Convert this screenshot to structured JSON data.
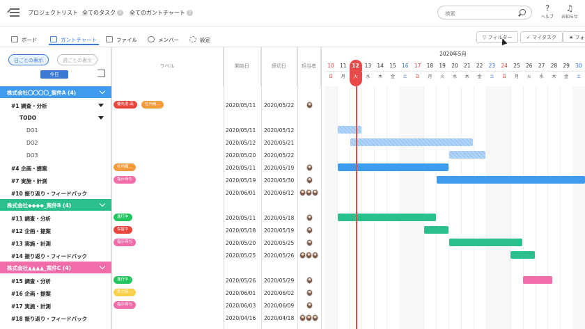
{
  "topbar": {
    "project_list": "プロジェクトリスト",
    "all_tasks": "全てのタスク",
    "all_gantt": "全てのガントチャート",
    "search_placeholder": "検索",
    "help": "ヘルプ",
    "notifications": "お知らせ"
  },
  "tabs": [
    {
      "label": "ボード"
    },
    {
      "label": "ガントチャート"
    },
    {
      "label": "ファイル"
    },
    {
      "label": "メンバー"
    },
    {
      "label": "設定"
    }
  ],
  "toolbar": {
    "filter": "フィルター",
    "my_tasks": "マイタスク",
    "favorites": "フォ"
  },
  "view_toggle": {
    "day": "日ごとの表示",
    "week": "週ごとの表示",
    "today": "今日"
  },
  "columns": {
    "label": "ラベル",
    "start": "開始日",
    "end": "締切日",
    "assignee": "担当者"
  },
  "calendar": {
    "month": "2020年5月",
    "days": [
      {
        "d": "10",
        "w": "日"
      },
      {
        "d": "11",
        "w": "月"
      },
      {
        "d": "12",
        "w": "火"
      },
      {
        "d": "13",
        "w": "水"
      },
      {
        "d": "14",
        "w": "木"
      },
      {
        "d": "15",
        "w": "金"
      },
      {
        "d": "16",
        "w": "土"
      },
      {
        "d": "17",
        "w": "日"
      },
      {
        "d": "18",
        "w": "月"
      },
      {
        "d": "19",
        "w": "火"
      },
      {
        "d": "20",
        "w": "水"
      },
      {
        "d": "21",
        "w": "木"
      },
      {
        "d": "22",
        "w": "金"
      },
      {
        "d": "23",
        "w": "土"
      },
      {
        "d": "24",
        "w": "日"
      },
      {
        "d": "25",
        "w": "月"
      },
      {
        "d": "26",
        "w": "火"
      },
      {
        "d": "27",
        "w": "水"
      },
      {
        "d": "28",
        "w": "木"
      },
      {
        "d": "29",
        "w": "金"
      },
      {
        "d": "30",
        "w": "土"
      }
    ]
  },
  "groups": [
    {
      "name": "株式会社〇〇〇〇_案件A (4)",
      "color": "#3f9bf0"
    },
    {
      "name": "株式会社◆◆◆◆_案件B (4)",
      "color": "#2cbf8e"
    },
    {
      "name": "株式会社▲▲▲▲_案件C (4)",
      "color": "#f06daa"
    }
  ],
  "tasks": [
    {
      "name": "#1 調査・分析",
      "labels": [
        {
          "t": "優先度:高",
          "c": "#e8453c"
        },
        {
          "t": "社内確…",
          "c": "#f39a3c"
        }
      ],
      "start": "2020/05/11",
      "end": "2020/05/22",
      "avatars": 1
    },
    {
      "name": "TODO",
      "labels": [],
      "start": "",
      "end": "",
      "avatars": 0
    },
    {
      "name": "DO1",
      "labels": [],
      "start": "2020/05/11",
      "end": "2020/05/12",
      "avatars": 0
    },
    {
      "name": "DO2",
      "labels": [],
      "start": "2020/05/12",
      "end": "2020/05/21",
      "avatars": 0
    },
    {
      "name": "DO3",
      "labels": [],
      "start": "2020/05/20",
      "end": "2020/05/22",
      "avatars": 0
    },
    {
      "name": "#4 企画・提案",
      "labels": [
        {
          "t": "社内確…",
          "c": "#f39a3c"
        }
      ],
      "start": "2020/05/11",
      "end": "2020/05/19",
      "avatars": 1
    },
    {
      "name": "#7 実施・計測",
      "labels": [
        {
          "t": "指示待ち",
          "c": "#f06daa"
        }
      ],
      "start": "2020/05/19",
      "end": "2020/05/30",
      "avatars": 1
    },
    {
      "name": "#10 振り返り・フィードバック",
      "labels": [],
      "start": "2020/06/01",
      "end": "2020/06/12",
      "avatars": 3
    },
    {
      "name": "#11 調査・分析",
      "labels": [
        {
          "t": "進行中",
          "c": "#22c55e"
        }
      ],
      "start": "2020/05/11",
      "end": "2020/05/18",
      "avatars": 1
    },
    {
      "name": "#12 企画・提案",
      "labels": [
        {
          "t": "保留中",
          "c": "#e8453c"
        }
      ],
      "start": "2020/05/18",
      "end": "2020/05/19",
      "avatars": 1
    },
    {
      "name": "#13 実施・計測",
      "labels": [
        {
          "t": "指示待ち",
          "c": "#f06daa"
        }
      ],
      "start": "2020/05/20",
      "end": "2020/05/25",
      "avatars": 1
    },
    {
      "name": "#14 振り返り・フィードバック",
      "labels": [],
      "start": "2020/05/25",
      "end": "2020/05/26",
      "avatars": 3
    },
    {
      "name": "#15 調査・分析",
      "labels": [
        {
          "t": "進行中",
          "c": "#22c55e"
        }
      ],
      "start": "2020/05/26",
      "end": "2020/05/29",
      "avatars": 1
    },
    {
      "name": "#16 企画・提案",
      "labels": [
        {
          "t": "気力待…",
          "c": "#f8d04a"
        }
      ],
      "start": "2020/06/01",
      "end": "2020/06/02",
      "avatars": 1
    },
    {
      "name": "#17 実施・計測",
      "labels": [
        {
          "t": "指示待ち",
          "c": "#f06daa"
        }
      ],
      "start": "2020/06/03",
      "end": "2020/06/09",
      "avatars": 1
    },
    {
      "name": "#18 振り返り・フィードバック",
      "labels": [],
      "start": "2020/04/16",
      "end": "2020/04/18",
      "avatars": 3
    }
  ]
}
